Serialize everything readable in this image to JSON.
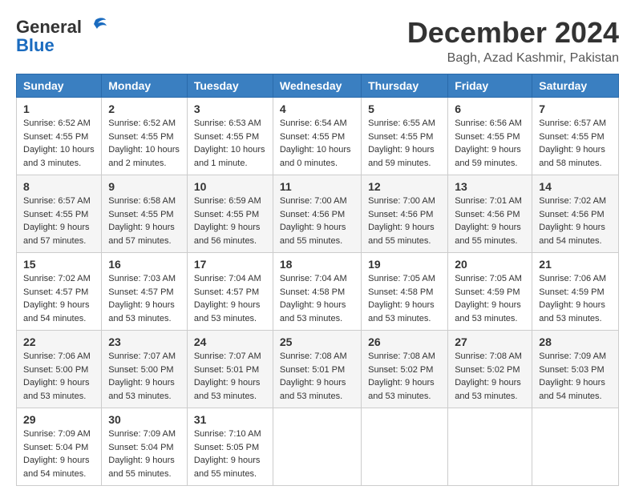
{
  "header": {
    "logo_line1": "General",
    "logo_line2": "Blue",
    "month_title": "December 2024",
    "location": "Bagh, Azad Kashmir, Pakistan"
  },
  "weekdays": [
    "Sunday",
    "Monday",
    "Tuesday",
    "Wednesday",
    "Thursday",
    "Friday",
    "Saturday"
  ],
  "weeks": [
    [
      {
        "day": "1",
        "sunrise": "6:52 AM",
        "sunset": "4:55 PM",
        "daylight": "10 hours and 3 minutes."
      },
      {
        "day": "2",
        "sunrise": "6:52 AM",
        "sunset": "4:55 PM",
        "daylight": "10 hours and 2 minutes."
      },
      {
        "day": "3",
        "sunrise": "6:53 AM",
        "sunset": "4:55 PM",
        "daylight": "10 hours and 1 minute."
      },
      {
        "day": "4",
        "sunrise": "6:54 AM",
        "sunset": "4:55 PM",
        "daylight": "10 hours and 0 minutes."
      },
      {
        "day": "5",
        "sunrise": "6:55 AM",
        "sunset": "4:55 PM",
        "daylight": "9 hours and 59 minutes."
      },
      {
        "day": "6",
        "sunrise": "6:56 AM",
        "sunset": "4:55 PM",
        "daylight": "9 hours and 59 minutes."
      },
      {
        "day": "7",
        "sunrise": "6:57 AM",
        "sunset": "4:55 PM",
        "daylight": "9 hours and 58 minutes."
      }
    ],
    [
      {
        "day": "8",
        "sunrise": "6:57 AM",
        "sunset": "4:55 PM",
        "daylight": "9 hours and 57 minutes."
      },
      {
        "day": "9",
        "sunrise": "6:58 AM",
        "sunset": "4:55 PM",
        "daylight": "9 hours and 57 minutes."
      },
      {
        "day": "10",
        "sunrise": "6:59 AM",
        "sunset": "4:55 PM",
        "daylight": "9 hours and 56 minutes."
      },
      {
        "day": "11",
        "sunrise": "7:00 AM",
        "sunset": "4:56 PM",
        "daylight": "9 hours and 55 minutes."
      },
      {
        "day": "12",
        "sunrise": "7:00 AM",
        "sunset": "4:56 PM",
        "daylight": "9 hours and 55 minutes."
      },
      {
        "day": "13",
        "sunrise": "7:01 AM",
        "sunset": "4:56 PM",
        "daylight": "9 hours and 55 minutes."
      },
      {
        "day": "14",
        "sunrise": "7:02 AM",
        "sunset": "4:56 PM",
        "daylight": "9 hours and 54 minutes."
      }
    ],
    [
      {
        "day": "15",
        "sunrise": "7:02 AM",
        "sunset": "4:57 PM",
        "daylight": "9 hours and 54 minutes."
      },
      {
        "day": "16",
        "sunrise": "7:03 AM",
        "sunset": "4:57 PM",
        "daylight": "9 hours and 53 minutes."
      },
      {
        "day": "17",
        "sunrise": "7:04 AM",
        "sunset": "4:57 PM",
        "daylight": "9 hours and 53 minutes."
      },
      {
        "day": "18",
        "sunrise": "7:04 AM",
        "sunset": "4:58 PM",
        "daylight": "9 hours and 53 minutes."
      },
      {
        "day": "19",
        "sunrise": "7:05 AM",
        "sunset": "4:58 PM",
        "daylight": "9 hours and 53 minutes."
      },
      {
        "day": "20",
        "sunrise": "7:05 AM",
        "sunset": "4:59 PM",
        "daylight": "9 hours and 53 minutes."
      },
      {
        "day": "21",
        "sunrise": "7:06 AM",
        "sunset": "4:59 PM",
        "daylight": "9 hours and 53 minutes."
      }
    ],
    [
      {
        "day": "22",
        "sunrise": "7:06 AM",
        "sunset": "5:00 PM",
        "daylight": "9 hours and 53 minutes."
      },
      {
        "day": "23",
        "sunrise": "7:07 AM",
        "sunset": "5:00 PM",
        "daylight": "9 hours and 53 minutes."
      },
      {
        "day": "24",
        "sunrise": "7:07 AM",
        "sunset": "5:01 PM",
        "daylight": "9 hours and 53 minutes."
      },
      {
        "day": "25",
        "sunrise": "7:08 AM",
        "sunset": "5:01 PM",
        "daylight": "9 hours and 53 minutes."
      },
      {
        "day": "26",
        "sunrise": "7:08 AM",
        "sunset": "5:02 PM",
        "daylight": "9 hours and 53 minutes."
      },
      {
        "day": "27",
        "sunrise": "7:08 AM",
        "sunset": "5:02 PM",
        "daylight": "9 hours and 53 minutes."
      },
      {
        "day": "28",
        "sunrise": "7:09 AM",
        "sunset": "5:03 PM",
        "daylight": "9 hours and 54 minutes."
      }
    ],
    [
      {
        "day": "29",
        "sunrise": "7:09 AM",
        "sunset": "5:04 PM",
        "daylight": "9 hours and 54 minutes."
      },
      {
        "day": "30",
        "sunrise": "7:09 AM",
        "sunset": "5:04 PM",
        "daylight": "9 hours and 55 minutes."
      },
      {
        "day": "31",
        "sunrise": "7:10 AM",
        "sunset": "5:05 PM",
        "daylight": "9 hours and 55 minutes."
      },
      null,
      null,
      null,
      null
    ]
  ]
}
